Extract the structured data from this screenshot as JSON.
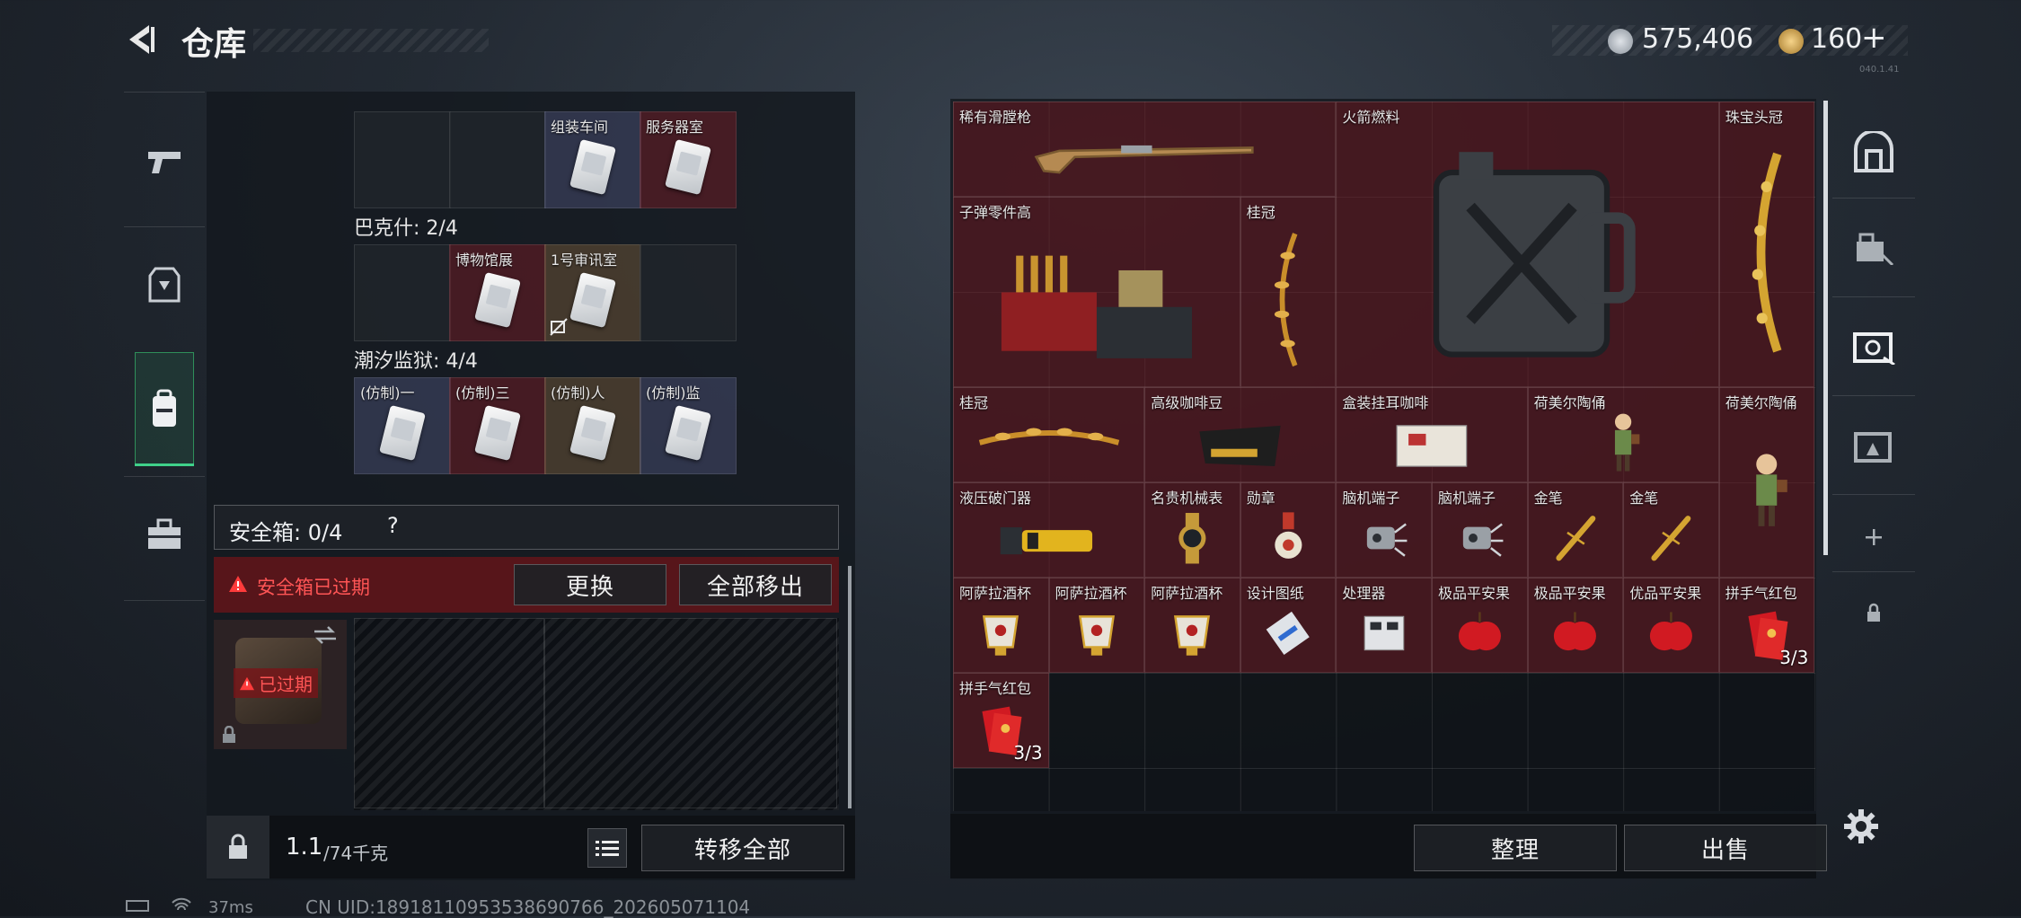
{
  "header": {
    "title": "仓库",
    "currency_a": "575,406",
    "currency_b": "160",
    "plus": "+",
    "version": "040.1.41"
  },
  "left_tabs": [
    {
      "icon": "pistol-icon"
    },
    {
      "icon": "armor-icon"
    },
    {
      "icon": "backpack-icon"
    },
    {
      "icon": "toolbox-icon"
    }
  ],
  "keys": {
    "sections": [
      {
        "title": "",
        "cells": [
          {
            "label": ""
          },
          {
            "label": ""
          },
          {
            "label": "组装车间",
            "color": "blue"
          },
          {
            "label": "服务器室",
            "color": "red"
          }
        ]
      },
      {
        "title": "巴克什: 2/4",
        "cells": [
          {
            "label": ""
          },
          {
            "label": "博物馆展",
            "color": "red"
          },
          {
            "label": "1号审讯室",
            "color": "gold"
          },
          {
            "label": ""
          }
        ]
      },
      {
        "title": "潮汐监狱: 4/4",
        "cells": [
          {
            "label": "(仿制)一",
            "color": "blue"
          },
          {
            "label": "(仿制)三",
            "color": "red"
          },
          {
            "label": "(仿制)人",
            "color": "gold"
          },
          {
            "label": "(仿制)监",
            "color": "blue"
          }
        ]
      }
    ]
  },
  "safebox": {
    "title": "安全箱: 0/4",
    "help": "?",
    "expired_msg": "安全箱已过期",
    "replace_label": "更换",
    "move_all_label": "全部移出",
    "expired_tag": "已过期"
  },
  "footer_left": {
    "weight": "1.1",
    "weight_unit": "/74千克",
    "transfer_label": "转移全部"
  },
  "status": {
    "ping": "37ms",
    "uid": "CN UID:189181109535386907​66_202605071104"
  },
  "stash": {
    "items": [
      {
        "name": "稀有滑膛枪",
        "color": "red",
        "img": "musket"
      },
      {
        "name": "火箭燃料",
        "color": "red",
        "img": "jerrycan"
      },
      {
        "name": "珠宝头冠",
        "color": "red",
        "img": "tiara"
      },
      {
        "name": "子弹零件高",
        "color": "red",
        "img": "ammo-crate"
      },
      {
        "name": "桂冠",
        "color": "red",
        "img": "laurel"
      },
      {
        "name": "桂冠",
        "color": "red",
        "img": "laurel-h"
      },
      {
        "name": "高级咖啡豆",
        "color": "red",
        "img": "coffee"
      },
      {
        "name": "盒装挂耳咖啡",
        "color": "red",
        "img": "coffee-box"
      },
      {
        "name": "荷美尔陶俑",
        "color": "red",
        "img": "figurine"
      },
      {
        "name": "荷美尔陶俑",
        "color": "red",
        "img": "figurine"
      },
      {
        "name": "液压破门器",
        "color": "red",
        "img": "breacher"
      },
      {
        "name": "名贵机械表",
        "color": "red",
        "img": "watch"
      },
      {
        "name": "勋章",
        "color": "red",
        "img": "medal"
      },
      {
        "name": "脑机端子",
        "color": "red",
        "img": "terminal"
      },
      {
        "name": "脑机端子",
        "color": "red",
        "img": "terminal"
      },
      {
        "name": "金笔",
        "color": "red",
        "img": "pen"
      },
      {
        "name": "金笔",
        "color": "red",
        "img": "pen"
      },
      {
        "name": "阿萨拉酒杯",
        "color": "red",
        "img": "cup"
      },
      {
        "name": "阿萨拉酒杯",
        "color": "red",
        "img": "cup"
      },
      {
        "name": "阿萨拉酒杯",
        "color": "red",
        "img": "cup"
      },
      {
        "name": "设计图纸",
        "color": "red",
        "img": "blueprint"
      },
      {
        "name": "处理器",
        "color": "red",
        "img": "processor"
      },
      {
        "name": "极品平安果",
        "color": "red",
        "img": "apple"
      },
      {
        "name": "极品平安果",
        "color": "red",
        "img": "apple"
      },
      {
        "name": "优品平安果",
        "color": "red",
        "img": "apple"
      },
      {
        "name": "拼手气红包",
        "color": "red",
        "img": "envelope",
        "count": "3/3"
      },
      {
        "name": "拼手气红包",
        "color": "red",
        "img": "envelope",
        "count": "3/3"
      }
    ],
    "organize_label": "整理",
    "sell_label": "出售"
  },
  "right_tabs": [
    {
      "icon": "vault-icon"
    },
    {
      "icon": "equipment-icon"
    },
    {
      "icon": "safe-icon"
    },
    {
      "icon": "storage-icon"
    },
    {
      "icon": "add-icon"
    },
    {
      "icon": "lock-icon"
    }
  ],
  "settings_icon": "gear-icon"
}
